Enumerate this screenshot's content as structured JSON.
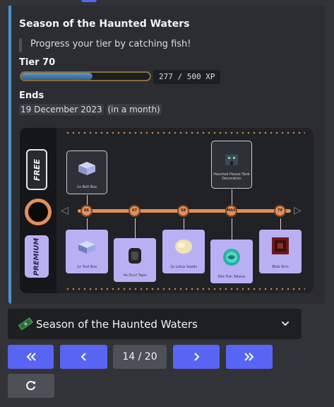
{
  "embed": {
    "title": "Season of the Haunted Waters",
    "quote": "Progress your tier by catching fish!",
    "tier_label": "Tier 70",
    "xp_text": "277 / 500 XP",
    "xp_progress": 0.554,
    "ends_label": "Ends",
    "end_date": "19 December 2023",
    "end_relative": "(in a month)",
    "accent_color": "#4f90cf"
  },
  "battle_pass": {
    "free_label": "FREE",
    "premium_label": "PREMIUM",
    "tiers": [
      "66",
      "67",
      "68",
      "MAX",
      "70"
    ],
    "free_rewards": [
      {
        "label": "1x Bolt Box",
        "icon": "bolt-box-icon"
      },
      {
        "label": "Haunted House Tank Decoration",
        "icon": "haunted-house-icon"
      }
    ],
    "premium_rewards": [
      {
        "label": "1x Tool Box",
        "icon": "tool-box-icon"
      },
      {
        "label": "4x Duct Tape",
        "icon": "duct-tape-icon"
      },
      {
        "label": "3x Lotus Seeds",
        "icon": "lotus-seeds-icon"
      },
      {
        "label": "50x Fish Tokens",
        "icon": "fish-token-icon"
      },
      {
        "label": "Blob Skin",
        "icon": "blob-skin-icon"
      }
    ],
    "track_color": "#e58e56",
    "premium_color": "#b9b0f4"
  },
  "season_select": {
    "icon": "money-icon",
    "selected": "Season of the Haunted Waters"
  },
  "pagination": {
    "first": "«",
    "prev": "‹",
    "page": "14 / 20",
    "next": "›",
    "last": "»"
  },
  "refresh": {
    "icon": "refresh-icon"
  }
}
